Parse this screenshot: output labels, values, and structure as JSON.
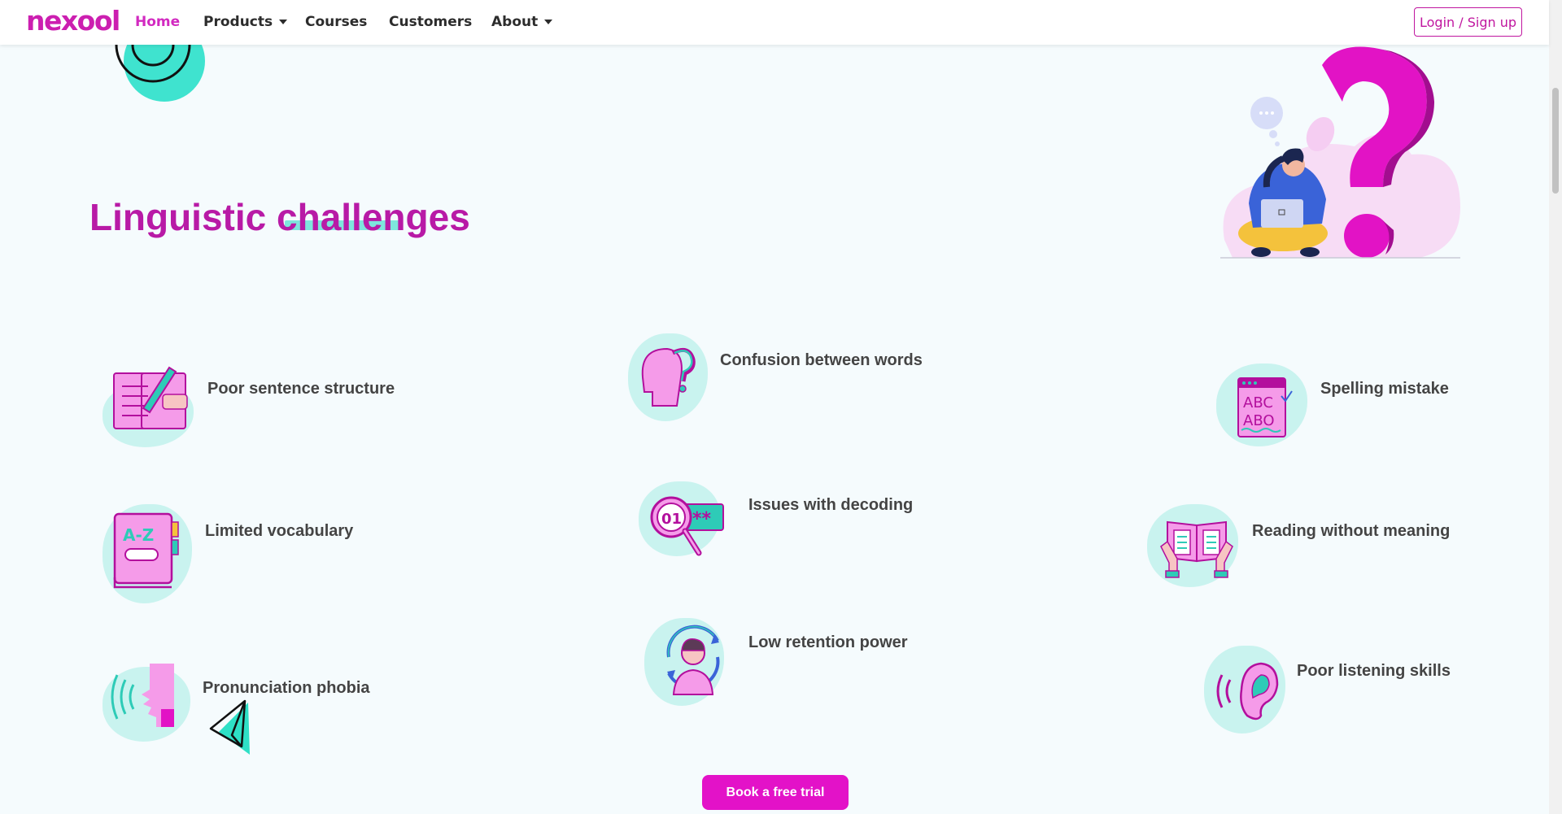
{
  "brand": {
    "name": "nexool"
  },
  "nav": {
    "items": [
      {
        "label": "Home"
      },
      {
        "label": "Products"
      },
      {
        "label": "Courses"
      },
      {
        "label": "Customers"
      },
      {
        "label": "About"
      }
    ],
    "login_label": "Login / Sign up"
  },
  "section": {
    "title_part1": "Linguistic",
    "title_part2": "challenges"
  },
  "challenges": [
    {
      "label": "Poor sentence structure",
      "icon": "writing-book-icon"
    },
    {
      "label": "Confusion between words",
      "icon": "head-question-icon"
    },
    {
      "label": "Spelling mistake",
      "icon": "abc-spelling-icon"
    },
    {
      "label": "Limited vocabulary",
      "icon": "dictionary-book-icon"
    },
    {
      "label": "Issues with decoding",
      "icon": "magnifier-code-icon"
    },
    {
      "label": "Reading without meaning",
      "icon": "open-book-hands-icon"
    },
    {
      "label": "Pronunciation phobia",
      "icon": "speaking-face-icon"
    },
    {
      "label": "Low retention power",
      "icon": "person-cycle-icon"
    },
    {
      "label": "Poor listening skills",
      "icon": "ear-icon"
    }
  ],
  "cta": {
    "label": "Book a free trial"
  },
  "colors": {
    "brand": "#cc1fb0",
    "accent": "#7ee6dd",
    "cta": "#e312c8"
  }
}
